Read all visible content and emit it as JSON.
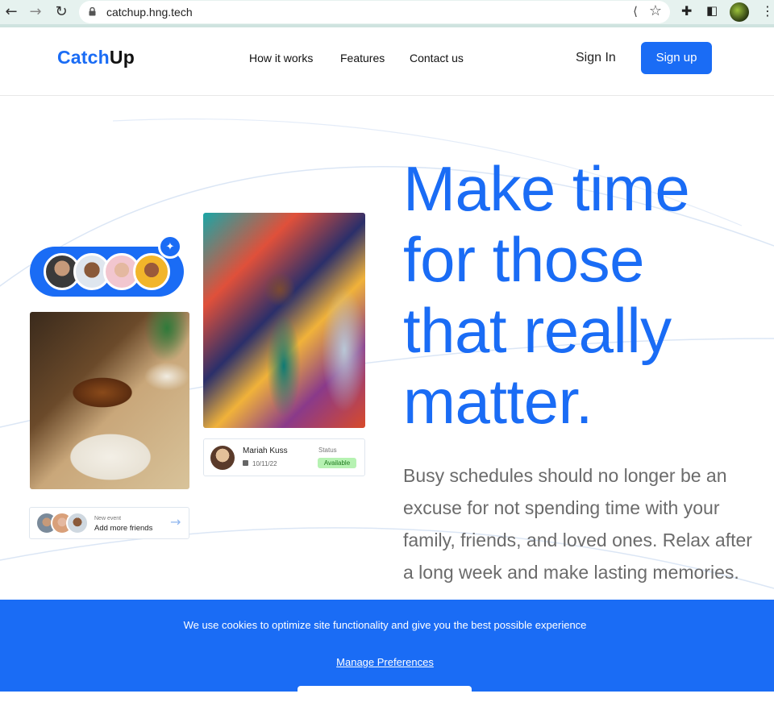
{
  "browser": {
    "url": "catchup.hng.tech",
    "icons": [
      "back-arrow-icon",
      "forward-arrow-icon",
      "reload-icon",
      "lock-icon",
      "share-icon",
      "star-icon",
      "extensions-icon",
      "side-panel-icon",
      "profile-avatar",
      "more-menu-icon"
    ]
  },
  "header": {
    "logo_part1": "Catch",
    "logo_part2": "Up",
    "nav": [
      "How it works",
      "Features",
      "Contact us"
    ],
    "sign_in": "Sign In",
    "sign_up": "Sign up"
  },
  "hero": {
    "headline": "Make time for those that really matter.",
    "subtext": "Busy schedules should no longer be an excuse for not spending time with your family, friends, and loved ones. Relax after a long week and make lasting memories."
  },
  "profile_card": {
    "name": "Mariah Kuss",
    "date": "10/11/22",
    "status_label": "Status",
    "status": "Available"
  },
  "event_card": {
    "label": "New event",
    "text": "Add more friends"
  },
  "cookie_banner": {
    "message": "We use cookies to optimize site functionality and give you the best possible experience",
    "manage": "Manage Preferences"
  },
  "colors": {
    "brand_blue": "#1a6cf5",
    "status_green": "#b6f2b2",
    "body_text": "#6b6b6b"
  }
}
